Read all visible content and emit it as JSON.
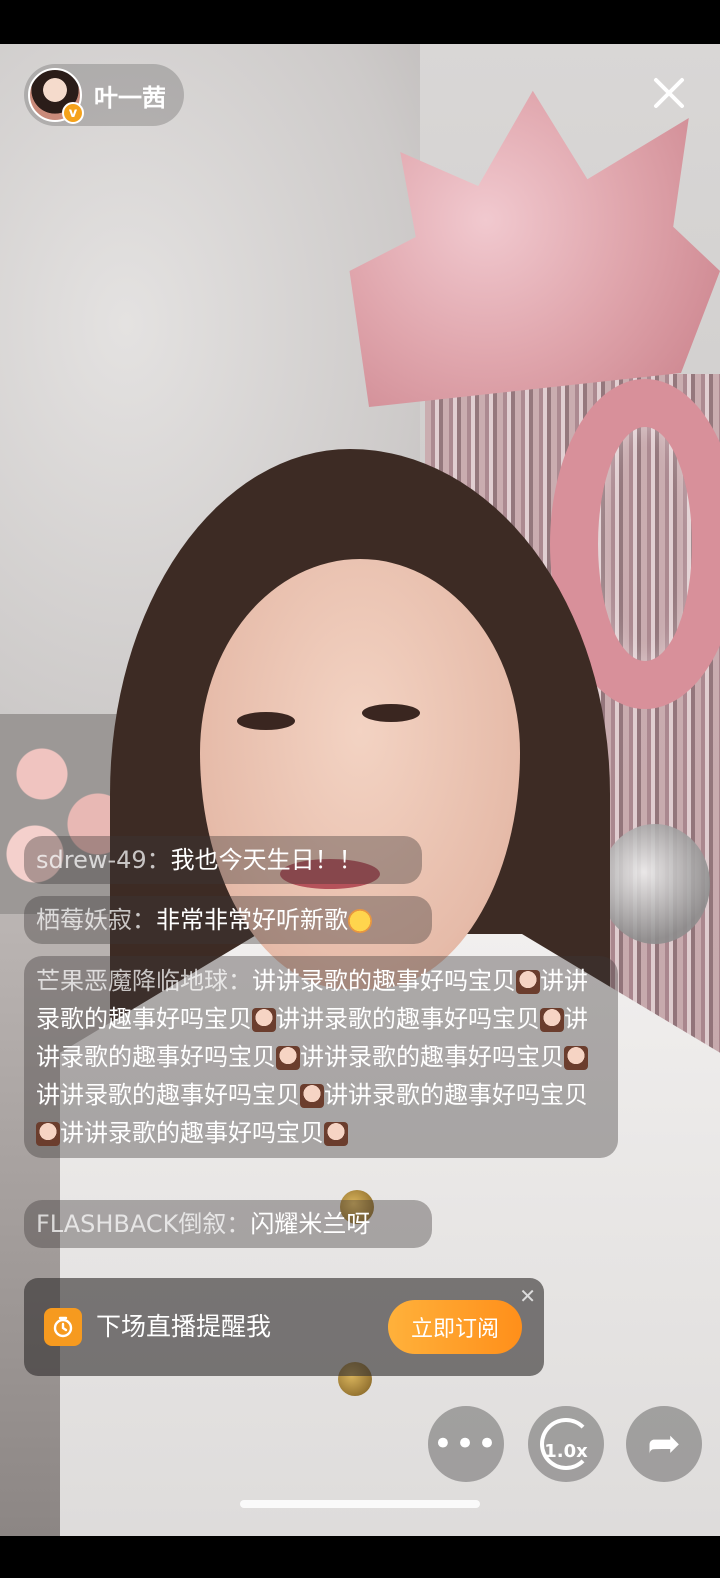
{
  "host": {
    "name": "叶一茜",
    "verified_mark": "v",
    "avatar_icon": "avatar-portrait"
  },
  "close_icon": "close-icon",
  "comments": [
    {
      "user": "sdrew-49：",
      "text": "我也今天生日！！"
    },
    {
      "user": "栖莓妖寂：",
      "text": "非常非常好听新歌",
      "trailing_emoji": "smiling-face-with-hearts"
    },
    {
      "user": "芒果恶魔降临地球：",
      "segments": [
        "讲讲录歌的趣事好吗宝贝",
        "讲讲录歌的趣事好吗宝贝",
        "讲讲录歌的趣事好吗宝贝",
        "讲讲录歌的趣事好吗宝贝",
        "讲讲录歌的趣事好吗宝贝",
        "讲讲录歌的趣事好吗宝贝",
        "讲讲录歌的趣事好吗宝贝",
        "讲讲录歌的趣事好吗宝贝"
      ],
      "segment_emoji": "host-avatar-emoji"
    },
    {
      "user": "FLASHBACK倒叙：",
      "text": "闪耀米兰呀"
    }
  ],
  "subscribe": {
    "text": "下场直播提醒我",
    "button": "立即订阅",
    "close_glyph": "✕",
    "icon": "timer-icon"
  },
  "controls": {
    "more_glyph": "•••",
    "speed_label": "1.0x",
    "share_glyph": "➦"
  },
  "colors": {
    "accent": "#ff9a1f",
    "verified": "#f5a21b"
  }
}
